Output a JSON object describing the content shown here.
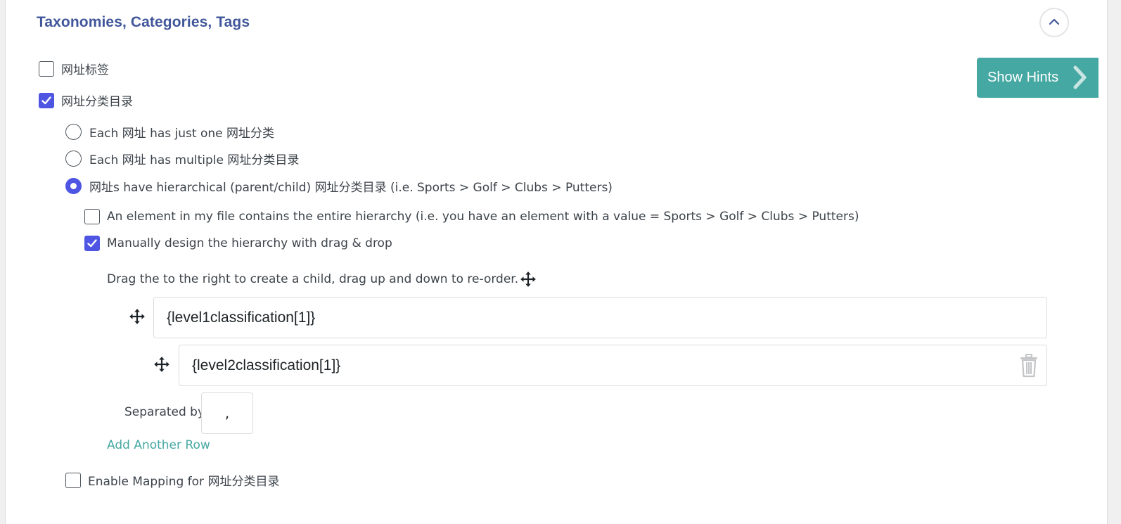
{
  "section": {
    "title": "Taxonomies, Categories, Tags"
  },
  "hints_button": {
    "label": "Show Hints"
  },
  "taxonomies": [
    {
      "label": "网址标签",
      "checked": false
    },
    {
      "label": "网址分类目录",
      "checked": true
    }
  ],
  "assignment_options": [
    {
      "label": "Each 网址 has just one 网址分类",
      "selected": false
    },
    {
      "label": "Each 网址 has multiple 网址分类目录",
      "selected": false
    },
    {
      "label": "网址s have hierarchical (parent/child) 网址分类目录 (i.e. Sports > Golf > Clubs > Putters)",
      "selected": true
    }
  ],
  "hierarchy_options": [
    {
      "label": "An element in my file contains the entire hierarchy (i.e. you have an element with a value = Sports > Golf > Clubs > Putters)",
      "checked": false
    },
    {
      "label": "Manually design the hierarchy with drag & drop",
      "checked": true
    }
  ],
  "drag_instructions": "Drag the to the right to create a child, drag up and down to re-order.",
  "hierarchy_rows": [
    {
      "value": "{level1classification[1]}",
      "level": 1
    },
    {
      "value": "{level2classification[1]}",
      "level": 2
    }
  ],
  "separator": {
    "label": "Separated by",
    "value": ","
  },
  "add_row_link": "Add Another Row",
  "enable_mapping": {
    "label": "Enable Mapping for 网址分类目录",
    "checked": false
  },
  "colors": {
    "accent": "#4f55e3",
    "teal": "#46a8a2",
    "title": "#40569a"
  },
  "icons": {
    "collapse": "chevron-up-icon",
    "hints": "chevron-right-icon",
    "drag": "move-arrows-icon",
    "delete": "trash-icon",
    "check": "checkmark-icon"
  }
}
